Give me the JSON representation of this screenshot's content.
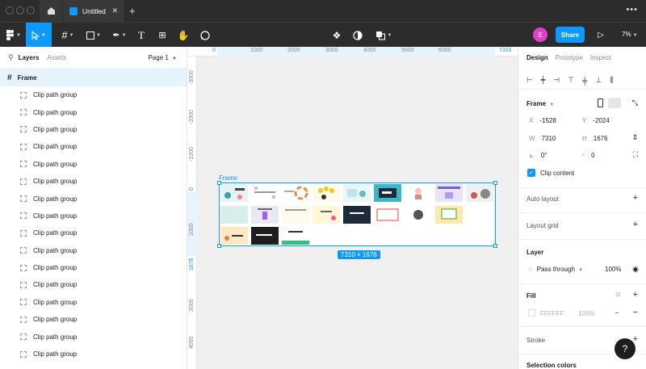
{
  "titlebar": {
    "tab_title": "Untitled",
    "new_tab": "+",
    "more": "•••"
  },
  "toolbar": {
    "avatar_initial": "E",
    "share_label": "Share",
    "zoom": "7%"
  },
  "layers_panel": {
    "tab_layers": "Layers",
    "tab_assets": "Assets",
    "page_selector": "Page 1",
    "frame_name": "Frame",
    "items": [
      "Clip path group",
      "Clip path group",
      "Clip path group",
      "Clip path group",
      "Clip path group",
      "Clip path group",
      "Clip path group",
      "Clip path group",
      "Clip path group",
      "Clip path group",
      "Clip path group",
      "Clip path group",
      "Clip path group",
      "Clip path group",
      "Clip path group",
      "Clip path group"
    ]
  },
  "canvas": {
    "ruler_top": [
      "0",
      "1000",
      "2000",
      "3000",
      "4000",
      "5000",
      "6000",
      "7310"
    ],
    "ruler_left": [
      "-3000",
      "-2000",
      "-1000",
      "0",
      "1000",
      "1676",
      "3000",
      "4000"
    ],
    "frame_label": "Frame",
    "size_badge": "7310 × 1676"
  },
  "design_panel": {
    "tabs": [
      "Design",
      "Prototype",
      "Inspect"
    ],
    "frame_section": "Frame",
    "x_label": "X",
    "x_value": "-1528",
    "y_label": "Y",
    "y_value": "-2024",
    "w_label": "W",
    "w_value": "7310",
    "h_label": "H",
    "h_value": "1676",
    "rotation": "0°",
    "radius": "0",
    "clip_content": "Clip content",
    "auto_layout": "Auto layout",
    "layout_grid": "Layout grid",
    "layer_section": "Layer",
    "blend_mode": "Pass through",
    "layer_opacity": "100%",
    "fill_section": "Fill",
    "fill_hex": "FFFFFF",
    "fill_opacity": "100%",
    "stroke_section": "Stroke",
    "selection_colors": "Selection colors"
  },
  "colors": {
    "accent": "#0d99ff",
    "toolbar": "#2c2c2c",
    "avatar": "#e040c8"
  }
}
